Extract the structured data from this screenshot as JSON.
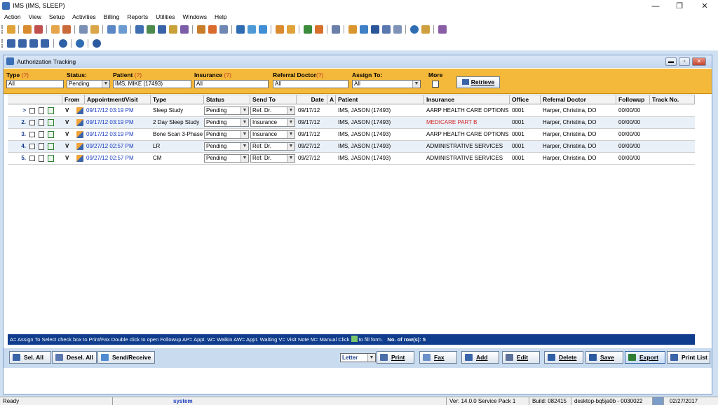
{
  "window": {
    "title": "IMS (IMS, SLEEP)",
    "minimize": "—",
    "restore": "❐",
    "close": "✕"
  },
  "menu": [
    "Action",
    "View",
    "Setup",
    "Activities",
    "Billing",
    "Reports",
    "Utilities",
    "Windows",
    "Help"
  ],
  "child": {
    "title": "Authorization Tracking"
  },
  "filters": {
    "type_label": "Type",
    "type_q": "(?)",
    "type_value": "All",
    "status_label": "Status:",
    "status_value": "Pending",
    "patient_label": "Patient",
    "patient_q": "(?)",
    "patient_value": "IMS, MIKE  (17493)",
    "insurance_label": "Insurance",
    "insurance_q": "(?)",
    "insurance_value": "All",
    "refdoc_label": "Referral Doctor",
    "refdoc_q": "(?)",
    "refdoc_value": "All",
    "assign_label": "Assign To:",
    "assign_value": "All",
    "more_label": "More",
    "retrieve_label": "Retrieve"
  },
  "grid": {
    "headers": [
      "From",
      "Appointment/Visit",
      "Type",
      "Status",
      "Send To",
      "Date",
      "A",
      "Patient",
      "Insurance",
      "Office",
      "Referral Doctor",
      "Followup",
      "Track No."
    ],
    "rows": [
      {
        "num": ">",
        "from": "V",
        "appt": "09/17/12 03:19 PM",
        "type": "Sleep Study",
        "status": "Pending",
        "sendto": "Ref. Dr.",
        "date": "09/17/12",
        "a": "",
        "patient": "IMS, JASON  (17493)",
        "insurance": "AARP HEALTH CARE OPTIONS",
        "ins_red": false,
        "office": "0001",
        "refdoc": "Harper, Christina, DO",
        "followup": "00/00/00",
        "track": ""
      },
      {
        "num": "2.",
        "from": "V",
        "appt": "09/17/12 03:19 PM",
        "type": "2 Day Sleep Study",
        "status": "Pending",
        "sendto": "Insurance",
        "date": "09/17/12",
        "a": "",
        "patient": "IMS, JASON  (17493)",
        "insurance": "MEDICARE PART B",
        "ins_red": true,
        "office": "0001",
        "refdoc": "Harper, Christina, DO",
        "followup": "00/00/00",
        "track": ""
      },
      {
        "num": "3.",
        "from": "V",
        "appt": "09/17/12 03:19 PM",
        "type": "Bone Scan 3-Phase",
        "status": "Pending",
        "sendto": "Insurance",
        "date": "09/17/12",
        "a": "",
        "patient": "IMS, JASON  (17493)",
        "insurance": "AARP HEALTH CARE OPTIONS",
        "ins_red": false,
        "office": "0001",
        "refdoc": "Harper, Christina, DO",
        "followup": "00/00/00",
        "track": ""
      },
      {
        "num": "4.",
        "from": "V",
        "appt": "09/27/12 02:57 PM",
        "type": "LR",
        "status": "Pending",
        "sendto": "Ref. Dr.",
        "date": "09/27/12",
        "a": "",
        "patient": "IMS, JASON  (17493)",
        "insurance": "ADMINISTRATIVE SERVICES",
        "ins_red": false,
        "office": "0001",
        "refdoc": "Harper, Christina, DO",
        "followup": "00/00/00",
        "track": ""
      },
      {
        "num": "5.",
        "from": "V",
        "appt": "09/27/12 02:57 PM",
        "type": "CM",
        "status": "Pending",
        "sendto": "Ref. Dr.",
        "date": "09/27/12",
        "a": "",
        "patient": "IMS, JASON  (17493)",
        "insurance": "ADMINISTRATIVE SERVICES",
        "ins_red": false,
        "office": "0001",
        "refdoc": "Harper, Christina, DO",
        "followup": "00/00/00",
        "track": ""
      }
    ]
  },
  "legend": {
    "text": "A= Assign To   Select check box to Print/Fax   Double click to open Followup   AP= Appt. W= Walkin  AW= Appt. Waiting  V= Visit Note  M= Manual   Click",
    "fill": "to fill form.",
    "rows_label": "No. of row(s): 5"
  },
  "buttons": {
    "sel_all": "Sel. All",
    "desel_all": "Desel. All",
    "send_receive": "Send/Receive",
    "letter": "Letter",
    "print": "Print",
    "fax": "Fax",
    "add": "Add",
    "edit": "Edit",
    "delete": "Delete",
    "save": "Save",
    "export": "Export",
    "print_list": "Print List"
  },
  "status": {
    "ready": "Ready",
    "user": "system",
    "version": "Ver: 14.0.0 Service Pack 1",
    "build": "Build: 082415",
    "machine": "desktop-bq5ja0b - 0030022",
    "date": "02/27/2017"
  }
}
